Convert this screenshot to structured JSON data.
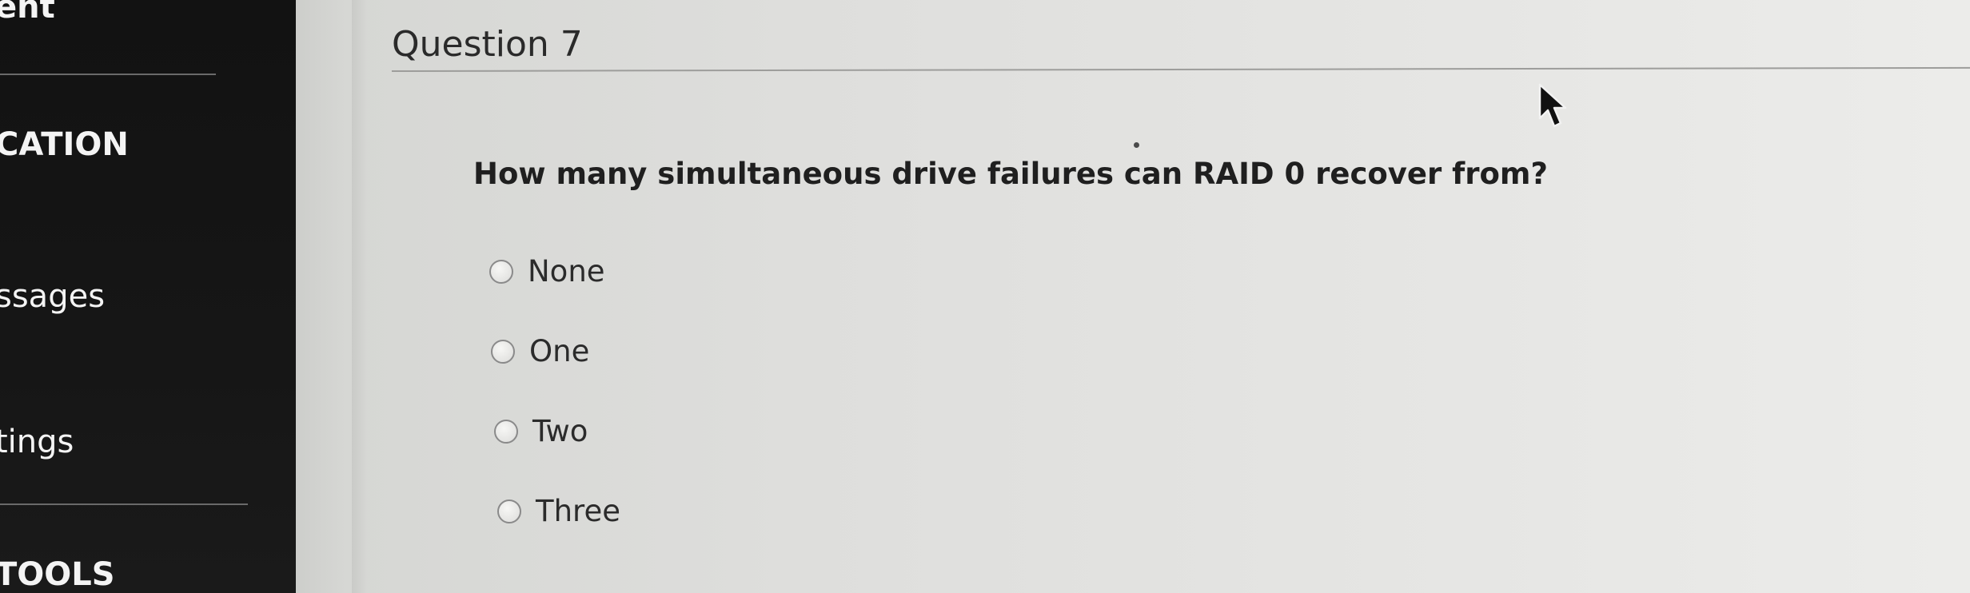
{
  "sidebar": {
    "items": [
      {
        "label": "ent"
      },
      {
        "label": "CATION"
      },
      {
        "label": "ssages"
      },
      {
        "label": "tings"
      },
      {
        "label": "TOOLS"
      }
    ]
  },
  "quiz": {
    "question_title": "Question 7",
    "question_text": "How many simultaneous drive failures can RAID 0 recover from?",
    "options": [
      {
        "label": "None",
        "selected": false
      },
      {
        "label": "One",
        "selected": false
      },
      {
        "label": "Two",
        "selected": false
      },
      {
        "label": "Three",
        "selected": false
      }
    ]
  },
  "icons": {
    "radio": "radio-unchecked-icon",
    "cursor": "mouse-pointer-icon"
  }
}
